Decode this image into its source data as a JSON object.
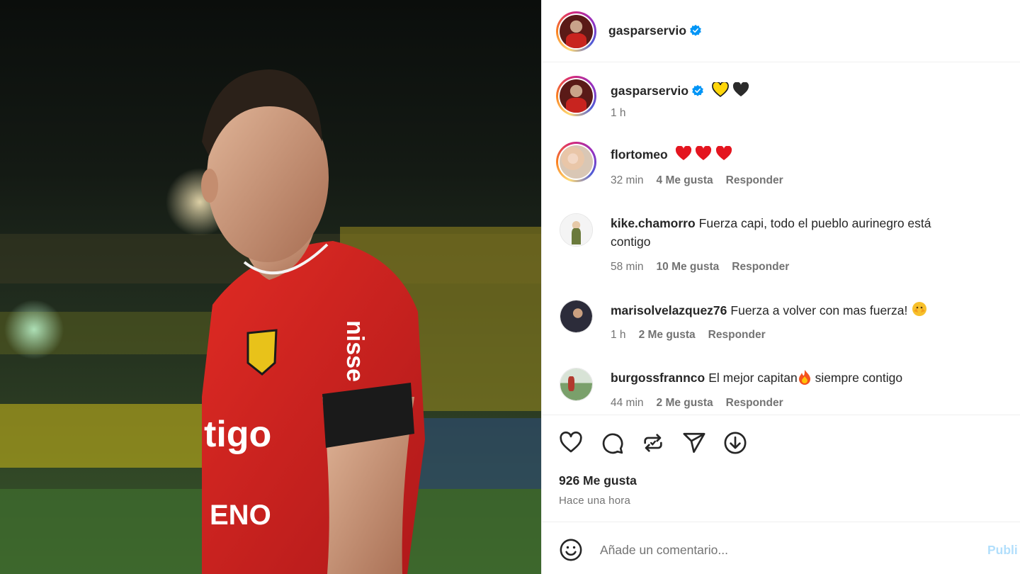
{
  "header": {
    "username": "gasparservio"
  },
  "caption": {
    "username": "gasparservio",
    "time": "1 h"
  },
  "comments": [
    {
      "username": "flortomeo",
      "text": "",
      "time": "32 min",
      "likes": "4 Me gusta",
      "reply": "Responder"
    },
    {
      "username": "kike.chamorro",
      "text": "Fuerza capi, todo el pueblo aurinegro está",
      "text2": "contigo",
      "time": "58 min",
      "likes": "10 Me gusta",
      "reply": "Responder"
    },
    {
      "username": "marisolvelazquez76",
      "text": "Fuerza a volver con mas fuerza!",
      "time": "1 h",
      "likes": "2 Me gusta",
      "reply": "Responder"
    },
    {
      "username": "burgossfrannco",
      "text": "El mejor capitan",
      "text_after": " siempre contigo",
      "time": "44 min",
      "likes": "2 Me gusta",
      "reply": "Responder"
    }
  ],
  "post": {
    "likes": "926 Me gusta",
    "when": "Hace una hora"
  },
  "composer": {
    "placeholder": "Añade un comentario...",
    "post_label": "Publi"
  },
  "photo": {
    "shirt_text": "tigo",
    "sleeve_text": "nisse",
    "front_text": "ENO"
  },
  "colors": {
    "verified": "#0095f6",
    "jersey": "#d7231f",
    "link_disabled": "#b2dffc"
  },
  "icons": [
    "verified-icon",
    "heart-icon",
    "comment-icon",
    "repost-icon",
    "share-icon",
    "save-icon",
    "emoji-icon"
  ]
}
